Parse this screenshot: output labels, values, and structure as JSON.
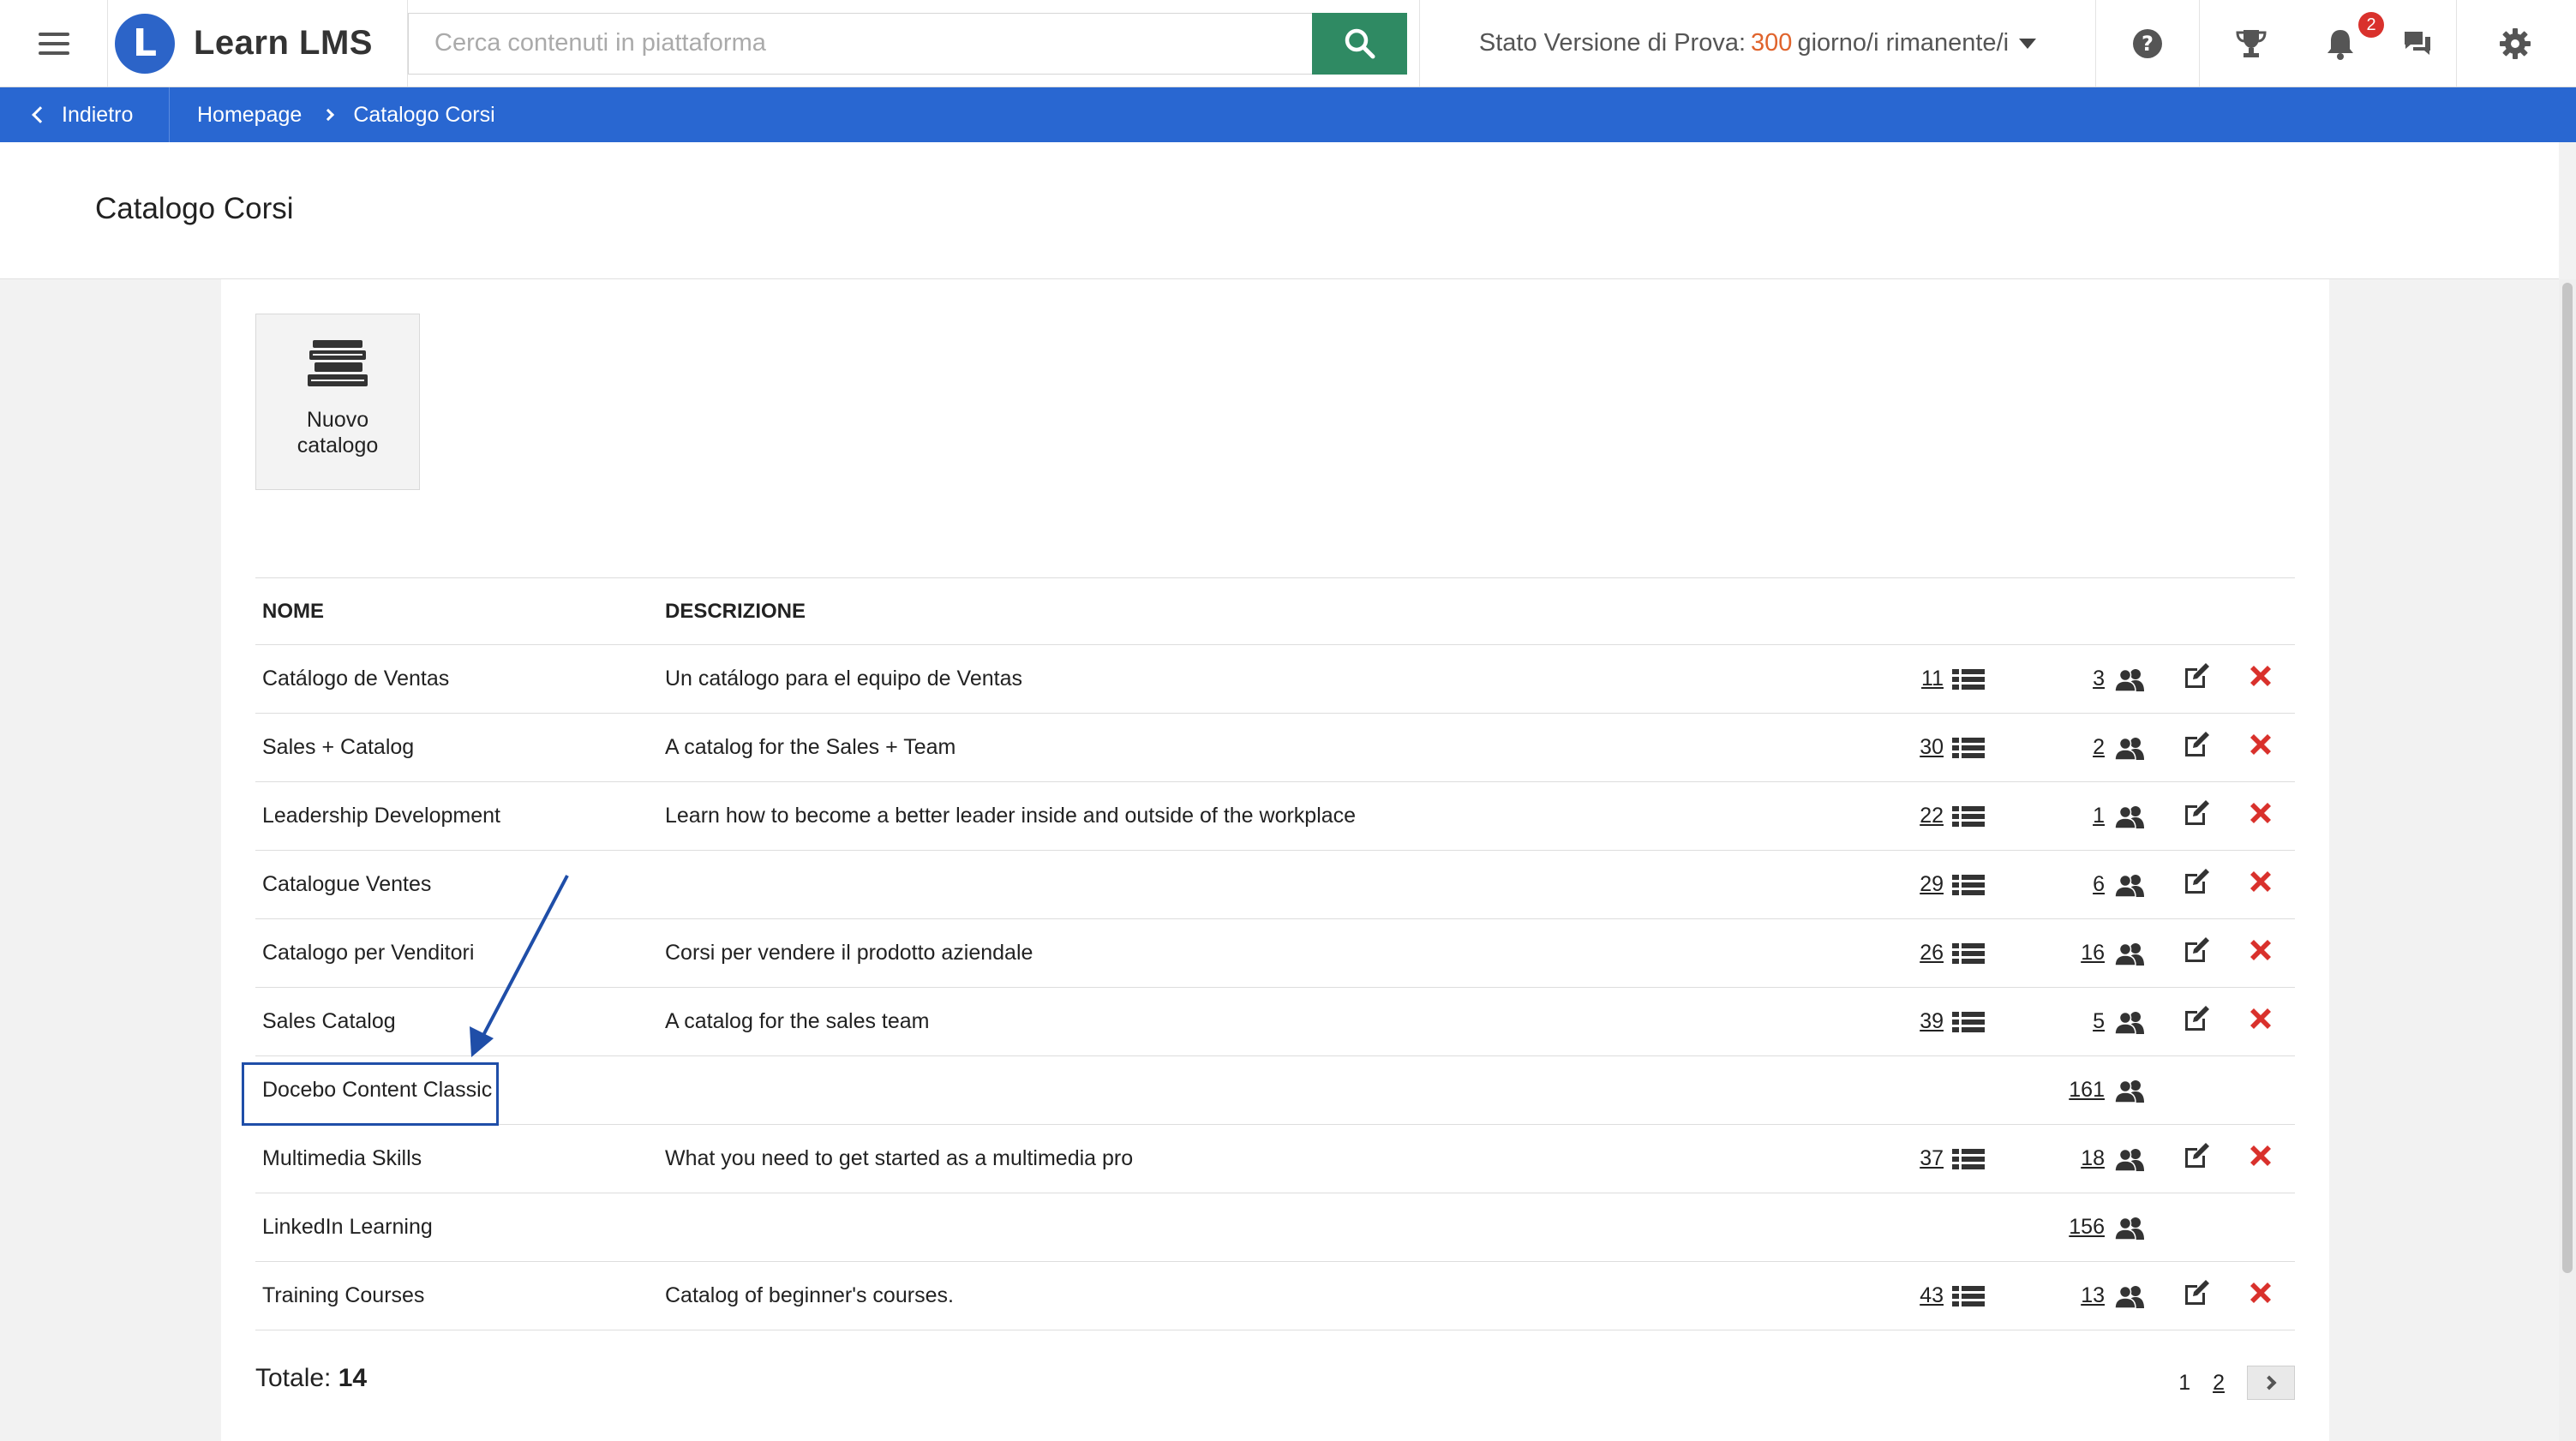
{
  "topbar": {
    "brand_name": "Learn LMS",
    "search_placeholder": "Cerca contenuti in piattaforma",
    "trial_prefix": "Stato Versione di Prova:",
    "trial_days": "300",
    "trial_suffix": "giorno/i rimanente/i",
    "notification_count": "2",
    "accent_color": "#2f8a63",
    "brand_color": "#2c64c8",
    "icons": [
      "menu-icon",
      "search-icon",
      "help-icon",
      "trophy-icon",
      "bell-icon",
      "chat-icon",
      "gear-icon"
    ]
  },
  "breadcrumb": {
    "back_label": "Indietro",
    "items": [
      "Homepage",
      "Catalogo Corsi"
    ],
    "bar_color": "#2967d1"
  },
  "page": {
    "title": "Catalogo Corsi"
  },
  "new_catalog": {
    "label_line1": "Nuovo",
    "label_line2": "catalogo"
  },
  "table": {
    "headers": {
      "name": "NOME",
      "description": "DESCRIZIONE"
    },
    "rows": [
      {
        "name": "Catálogo de Ventas",
        "description": "Un catálogo para el equipo de Ventas",
        "courses": "11",
        "users": "3",
        "editable": true
      },
      {
        "name": "Sales + Catalog",
        "description": "A catalog for the Sales + Team",
        "courses": "30",
        "users": "2",
        "editable": true
      },
      {
        "name": "Leadership Development",
        "description": "Learn how to become a better leader inside and outside of the workplace",
        "courses": "22",
        "users": "1",
        "editable": true
      },
      {
        "name": "Catalogue Ventes",
        "description": "",
        "courses": "29",
        "users": "6",
        "editable": true
      },
      {
        "name": "Catalogo per Venditori",
        "description": "Corsi per vendere il prodotto aziendale",
        "courses": "26",
        "users": "16",
        "editable": true
      },
      {
        "name": "Sales Catalog",
        "description": "A catalog for the sales team",
        "courses": "39",
        "users": "5",
        "editable": true
      },
      {
        "name": "Docebo Content Classic",
        "description": "",
        "courses": "",
        "users": "161",
        "editable": false
      },
      {
        "name": "Multimedia Skills",
        "description": "What you need to get started as a multimedia pro",
        "courses": "37",
        "users": "18",
        "editable": true
      },
      {
        "name": "LinkedIn Learning",
        "description": "",
        "courses": "",
        "users": "156",
        "editable": false
      },
      {
        "name": "Training Courses",
        "description": "Catalog of beginner's courses.",
        "courses": "43",
        "users": "13",
        "editable": true
      }
    ]
  },
  "footer": {
    "total_label": "Totale:",
    "total_value": "14",
    "pages": [
      "1",
      "2"
    ]
  },
  "annotation": {
    "highlight_color": "#1f4ea8"
  }
}
